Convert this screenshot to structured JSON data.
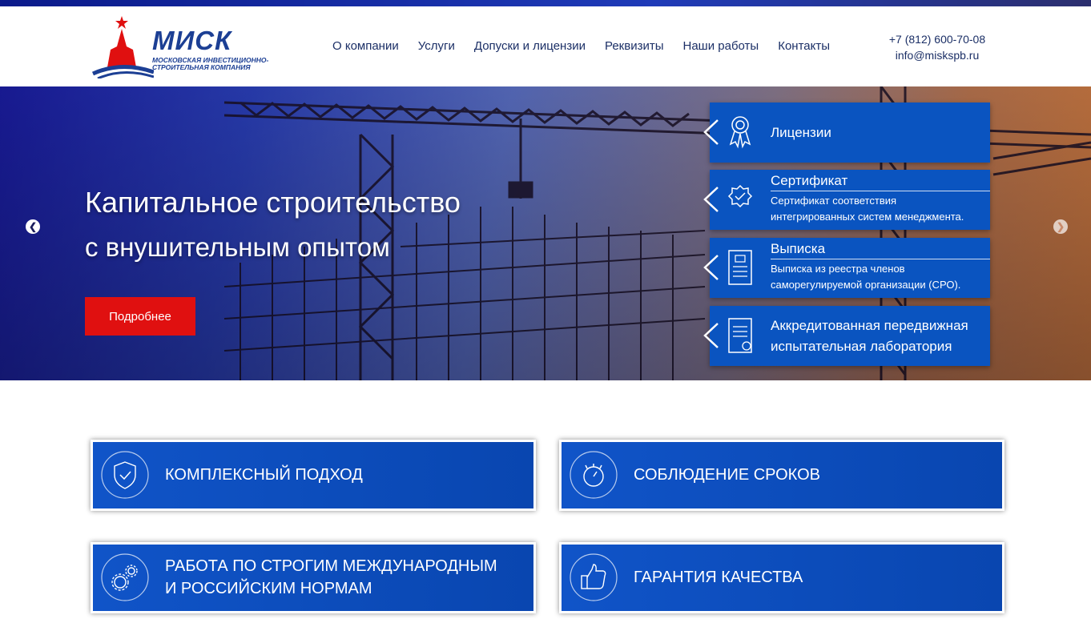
{
  "logo": {
    "name": "МИСК",
    "subtitle": "Московская инвестиционно-строительная компания"
  },
  "nav": [
    {
      "label": "О компании"
    },
    {
      "label": "Услуги"
    },
    {
      "label": "Допуски и лицензии"
    },
    {
      "label": "Реквизиты"
    },
    {
      "label": "Наши работы"
    },
    {
      "label": "Контакты"
    }
  ],
  "contacts": {
    "phone": "+7 (812) 600-70-08",
    "email": "info@miskspb.ru"
  },
  "hero": {
    "title": "Капитальное строительство",
    "subtitle": "с внушительным опытом",
    "button": "Подробнее",
    "prev_icon": "chevron-left-circle-icon",
    "next_icon": "chevron-right-circle-icon"
  },
  "panels": [
    {
      "title": "Лицензии",
      "desc1": "",
      "desc2": "",
      "icon": "award-ribbon-icon"
    },
    {
      "title": "Сертификат",
      "desc1": "Сертификат соответствия",
      "desc2": "интегрированных систем менеджмента.",
      "icon": "certificate-badge-icon"
    },
    {
      "title": "Выписка",
      "desc1": "Выписка из реестра членов",
      "desc2": "саморегулируемой организации (СРО).",
      "icon": "document-icon"
    },
    {
      "title1": "Аккредитованная передвижная",
      "title2": "испытательная лаборатория",
      "icon": "document-seal-icon"
    }
  ],
  "features": [
    {
      "line1": "Комплексный подход",
      "icon": "shield-check-icon"
    },
    {
      "line1": "Соблюдение сроков",
      "icon": "stopwatch-icon"
    },
    {
      "line1": "Работа по строгим международным",
      "line2": "и российским нормам",
      "icon": "gears-icon"
    },
    {
      "line1": "Гарантия качества",
      "icon": "thumbs-up-icon"
    }
  ],
  "colors": {
    "brand_blue": "#0a54c0",
    "accent_red": "#e01010",
    "nav_text": "#1b2f66"
  }
}
